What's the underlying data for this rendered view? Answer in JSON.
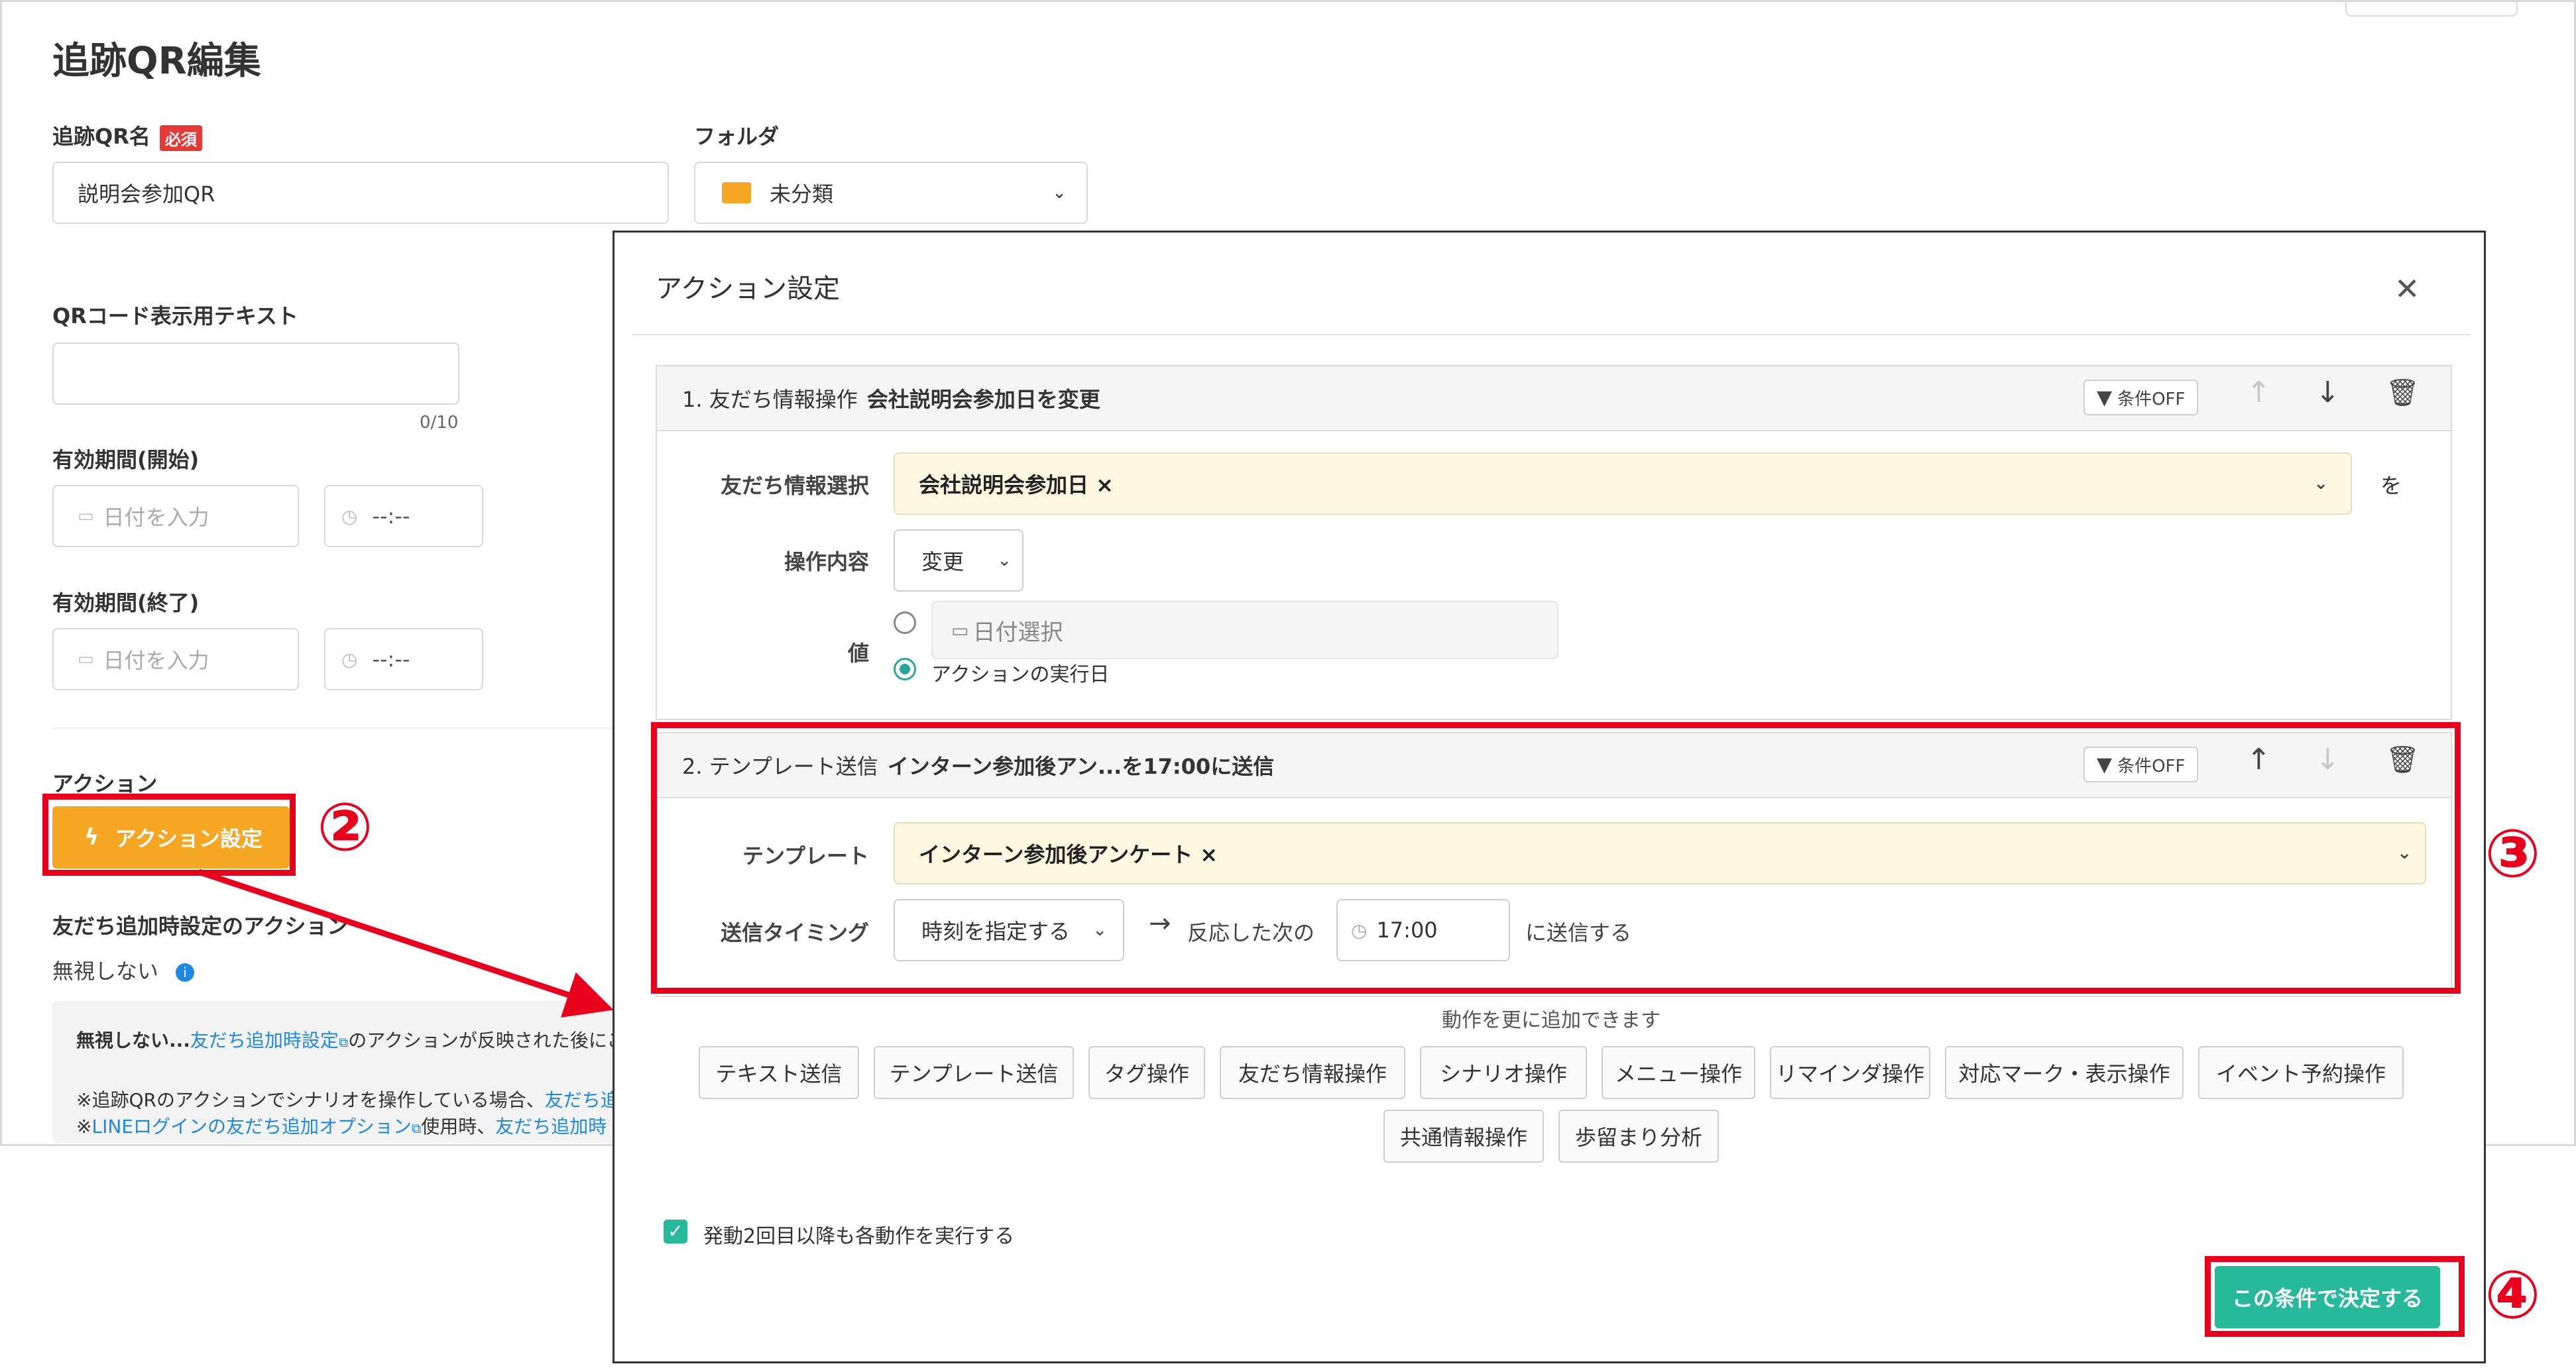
{
  "page": {
    "title": "追跡QR編集",
    "qr_name_label": "追跡QR名",
    "required_badge": "必須",
    "qr_name_value": "説明会参加QR",
    "folder_label": "フォルダ",
    "folder_value": "未分類",
    "display_text_label": "QRコード表示用テキスト",
    "display_text_counter": "0/10",
    "valid_start_label": "有効期間(開始)",
    "valid_end_label": "有効期間(終了)",
    "date_placeholder": "日付を入力",
    "time_placeholder": "--:--",
    "action_label": "アクション",
    "action_button": "アクション設定",
    "friend_add_action_label": "友だち追加時設定のアクション",
    "ignore_label": "無視しない",
    "notice_line1_prefix": "無視しない...",
    "notice_line1_link": "友だち追加時設定",
    "notice_line1_suffix": "のアクションが反映された後にこ",
    "notice_line2_prefix": "※追跡QRのアクションでシナリオを操作している場合、",
    "notice_line2_link": "友だち追",
    "notice_line3_link1": "LINEログインの友だち追加オプション",
    "notice_line3_mid": "使用時、",
    "notice_line3_link2": "友だち追加時",
    "notice_line3_prefix": "※"
  },
  "modal": {
    "title": "アクション設定",
    "close_glyph": "✕",
    "action1": {
      "number": "1. 友だち情報操作",
      "summary": "会社説明会参加日を変更",
      "condition_button": "条件OFF",
      "friend_info_label": "友だち情報選択",
      "friend_info_value": "会社説明会参加日 ×",
      "suffix": "を",
      "operation_label": "操作内容",
      "operation_value": "変更",
      "value_label": "値",
      "date_select_placeholder": "日付選択",
      "execution_date_option": "アクションの実行日"
    },
    "action2": {
      "number": "2. テンプレート送信",
      "summary": "インターン参加後アン...を17:00に送信",
      "condition_button": "条件OFF",
      "template_label": "テンプレート",
      "template_value": "インターン参加後アンケート ×",
      "timing_label": "送信タイミング",
      "timing_value": "時刻を指定する",
      "next_reaction_text": "反応した次の",
      "time_value": "17:00",
      "send_suffix": "に送信する"
    },
    "add_more_text": "動作を更に追加できます",
    "add_buttons_row1": [
      "テキスト送信",
      "テンプレート送信",
      "タグ操作",
      "友だち情報操作",
      "シナリオ操作",
      "メニュー操作",
      "リマインダ操作",
      "対応マーク・表示操作",
      "イベント予約操作"
    ],
    "add_buttons_row2": [
      "共通情報操作",
      "歩留まり分析"
    ],
    "repeat_checkbox_label": "発動2回目以降も各動作を実行する",
    "confirm_button": "この条件で決定する"
  },
  "annotations": {
    "step2": "②",
    "step3": "③",
    "step4": "④"
  },
  "colors": {
    "accent_orange": "#f5a623",
    "accent_teal": "#26b99a",
    "highlight_red": "#e8001c",
    "select_yellow": "#fff8e1",
    "link_blue": "#1e88e5"
  }
}
